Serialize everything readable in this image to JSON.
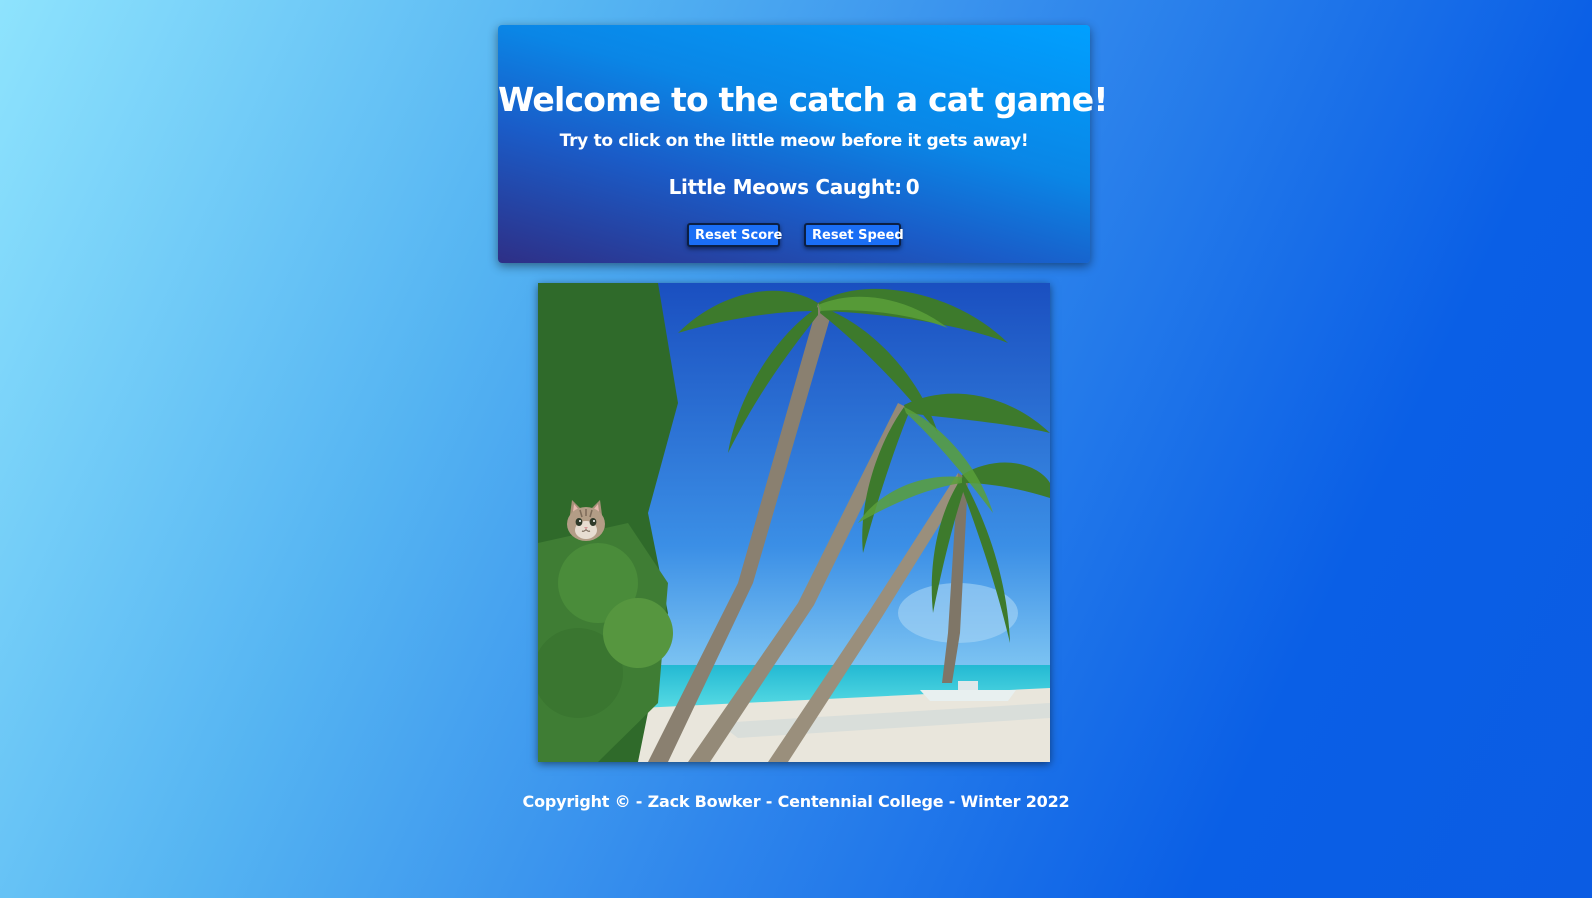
{
  "header": {
    "title": "Welcome to the catch a cat game!",
    "subtitle": "Try to click on the little meow before it gets away!",
    "score_label": "Little Meows Caught:",
    "score_value": "0"
  },
  "buttons": {
    "reset_score": "Reset Score",
    "reset_speed": "Reset Speed"
  },
  "game": {
    "background_scene": "tropical-beach-palm-trees",
    "target": "cat-face"
  },
  "footer": {
    "copyright": "Copyright © - Zack Bowker - Centennial College - Winter 2022"
  },
  "colors": {
    "button_bg": "#1a6ef5",
    "card_top": "#00a0ff",
    "card_bottom": "#2e2f86"
  }
}
